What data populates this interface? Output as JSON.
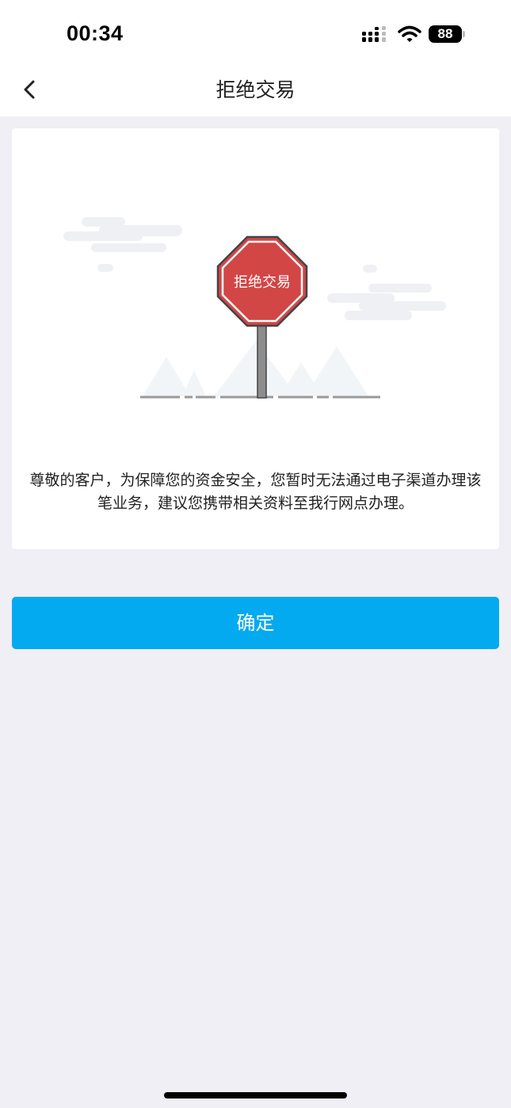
{
  "status_bar": {
    "time": "00:34",
    "battery": "88",
    "icons": [
      "signal-icon",
      "wifi-icon",
      "battery-icon"
    ]
  },
  "nav": {
    "title": "拒绝交易",
    "back_icon": "chevron-left-icon"
  },
  "illustration": {
    "sign_text": "拒绝交易",
    "sign_color": "#d24646",
    "pole_color": "#8d8d8d"
  },
  "message": {
    "line1": "尊敬的客户，为保障您的资金安全，您暂时无法通过电子渠道办理该",
    "line2": "笔业务，建议您携带相关资料至我行网点办理。"
  },
  "confirm": {
    "label": "确定",
    "color": "#04aaf0"
  }
}
